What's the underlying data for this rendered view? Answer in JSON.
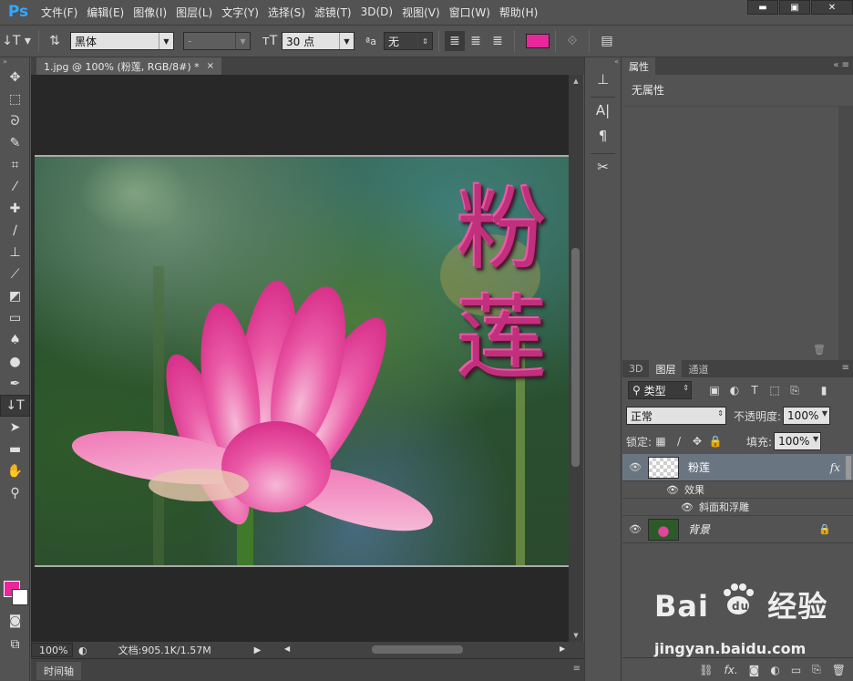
{
  "app": {
    "logo": "Ps"
  },
  "menu": [
    "文件(F)",
    "编辑(E)",
    "图像(I)",
    "图层(L)",
    "文字(Y)",
    "选择(S)",
    "滤镜(T)",
    "3D(D)",
    "视图(V)",
    "窗口(W)",
    "帮助(H)"
  ],
  "window_controls": {
    "minimize": "▬",
    "restore": "▣",
    "close": "✕"
  },
  "options_bar": {
    "font_family": "黑体",
    "font_style": "-",
    "font_size": "30 点",
    "antialias": "无",
    "text_color": "#e8289a"
  },
  "document": {
    "tab_title": "1.jpg @ 100% (粉莲, RGB/8#) *",
    "tab_close": "×",
    "text_line1": "粉",
    "text_line2": "莲"
  },
  "status": {
    "zoom": "100%",
    "doc_info": "文档:905.1K/1.57M"
  },
  "timeline": {
    "label": "时间轴"
  },
  "properties_panel": {
    "tab": "属性",
    "body": "无属性"
  },
  "layers_panel": {
    "tabs": [
      "3D",
      "图层",
      "通道"
    ],
    "filter_kind": "类型",
    "blend_mode": "正常",
    "opacity_label": "不透明度:",
    "opacity_value": "100%",
    "lock_label": "锁定:",
    "fill_label": "填充:",
    "fill_value": "100%",
    "layers": [
      {
        "name": "粉莲",
        "fx": "fx",
        "selected": true
      },
      {
        "name": "背景",
        "locked": true
      }
    ],
    "effects_label": "效果",
    "effect_name": "斜面和浮雕"
  },
  "colors": {
    "foreground": "#e8289a",
    "background": "#ffffff",
    "text_fill": "#c0307c"
  },
  "watermark": {
    "brand_left": "Bai",
    "brand_right": "经验",
    "url": "jingyan.baidu.com"
  }
}
